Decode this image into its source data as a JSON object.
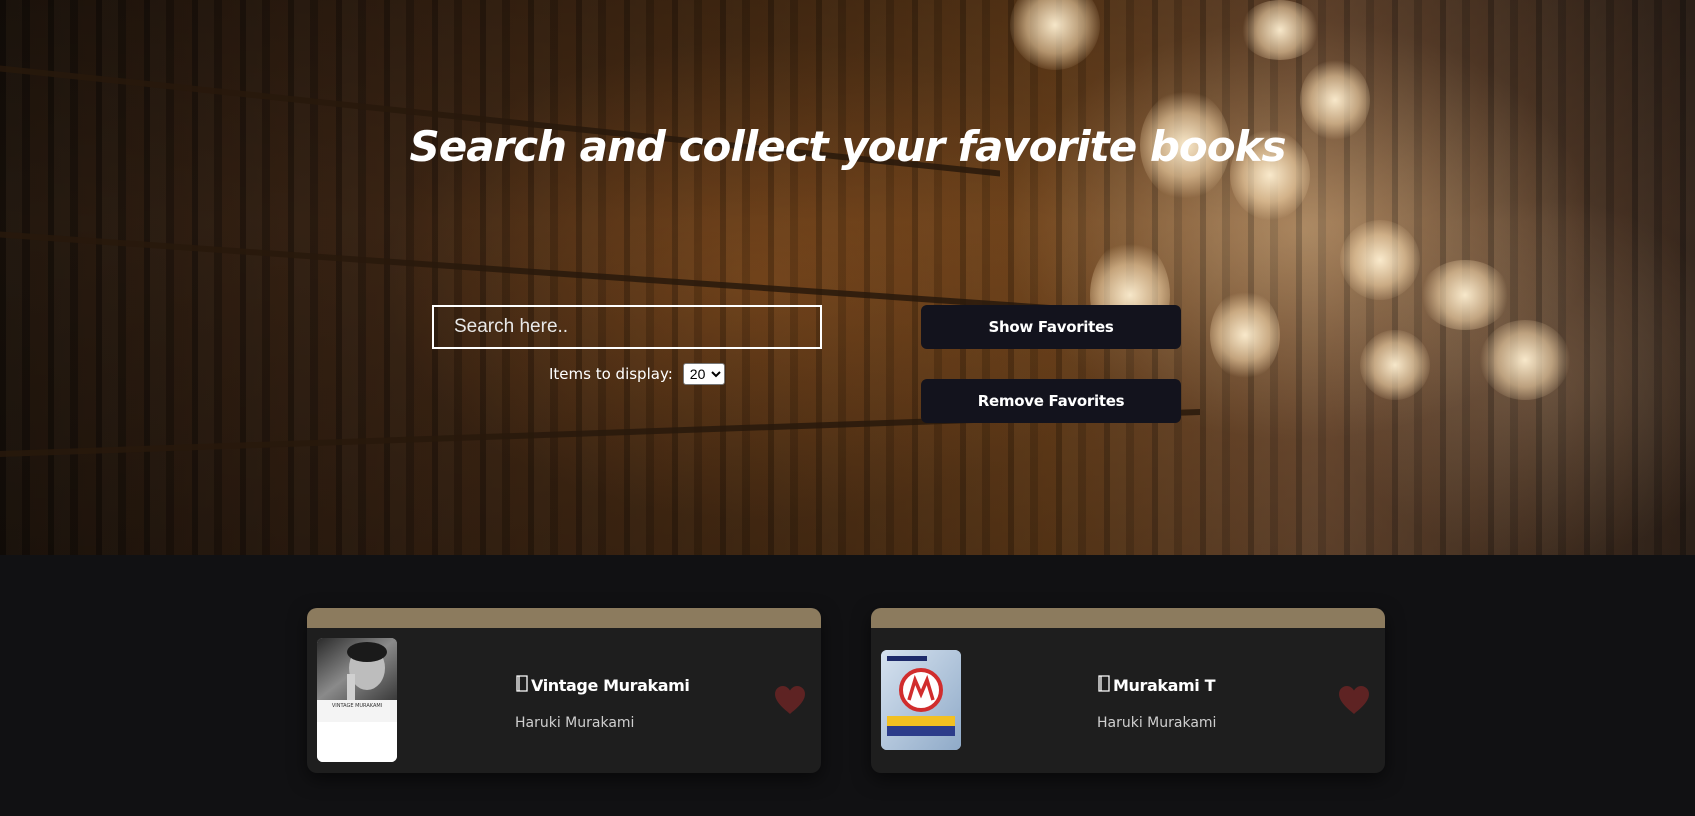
{
  "hero": {
    "title": "Search and collect your favorite books",
    "search_placeholder": "Search here..",
    "items_label": "Items to display:",
    "items_selected": "20",
    "show_favorites_label": "Show Favorites",
    "remove_favorites_label": "Remove Favorites"
  },
  "books": [
    {
      "title": "Vintage Murakami",
      "author": "Haruki Murakami",
      "cover_text": "VINTAGE MURAKAMI",
      "book_icon": "book-icon",
      "favorite_icon": "heart-icon"
    },
    {
      "title": "Murakami T",
      "author": "Haruki Murakami",
      "book_icon": "book-icon",
      "favorite_icon": "heart-icon"
    }
  ],
  "colors": {
    "page_background": "#111113",
    "button_background": "#13131d",
    "card_background": "#1e1e1e",
    "card_band": "#8c7b5e",
    "heart": "#5e2323"
  }
}
